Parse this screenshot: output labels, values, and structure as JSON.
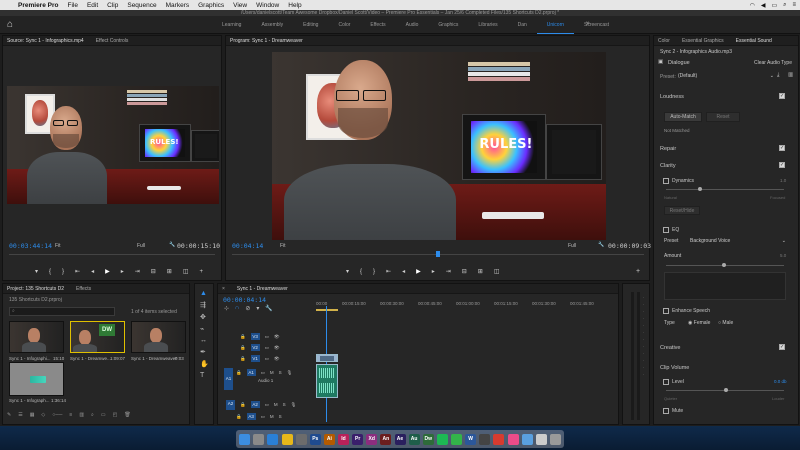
{
  "menubar": {
    "app": "Premiere Pro",
    "items": [
      "File",
      "Edit",
      "Clip",
      "Sequence",
      "Markers",
      "Graphics",
      "View",
      "Window",
      "Help"
    ],
    "status_icons": [
      "wifi-icon",
      "volume-icon",
      "battery-icon",
      "search-icon",
      "menu-icon"
    ]
  },
  "path": "/Users/danielscott/Team Awesome Dropbox/Daniel Scott/Video – Premiere Pro Essentials – Jan 25/6 Completed Files/135 Shortcuts D2.prproj *",
  "workspaces": {
    "tabs": [
      "Learning",
      "Assembly",
      "Editing",
      "Color",
      "Effects",
      "Audio",
      "Graphics",
      "Libraries",
      "Dan",
      "Unicorn",
      "Screencast"
    ],
    "active": "Unicorn",
    "more": "»"
  },
  "source": {
    "tab_label": "Source: Sync 1 - Infographics.mp4",
    "tab2": "Effect Controls",
    "timecode": "00:03:44:14",
    "fit": "Fit",
    "quality": "Full",
    "duration": "00:00:15:10"
  },
  "program": {
    "tab_label": "Program: Sync 1 - Dreamweaver",
    "timecode": "00:04:14",
    "fit": "Fit",
    "quality": "Full",
    "duration": "00:00:09:03",
    "monitor_text": "RULES!"
  },
  "project": {
    "tab_label": "Project: 135 Shortcuts D2",
    "tab2": "Effects",
    "filename": "135 Shortcuts D2.prproj",
    "selection": "1 of 4 items selected",
    "items": [
      {
        "name": "Sync 1 - Infographi...",
        "duration": "15:10"
      },
      {
        "name": "Sync 1 - Dreamwe...",
        "duration": "1:09:07"
      },
      {
        "name": "Sync 1 - Dreamweaver",
        "duration": "9:03"
      },
      {
        "name": "Sync 1 - Infograph...",
        "duration": "1:36:14"
      }
    ]
  },
  "timeline": {
    "tab_label": "Sync 1 - Dreamweaver",
    "timecode": "00:00:04:14",
    "ruler": [
      "00:00",
      "00:00:15:00",
      "00:00:30:00",
      "00:00:45:00",
      "00:01:00:00",
      "00:01:15:00",
      "00:01:30:00",
      "00:01:45:00"
    ],
    "tracks_video": [
      "V3",
      "V2",
      "V1"
    ],
    "tracks_audio": [
      "A1",
      "A2",
      "A3"
    ],
    "audio_label": "Audio 1",
    "audio_master": "A1"
  },
  "essential_sound": {
    "tabs": [
      "Color",
      "Essential Graphics",
      "Essential Sound"
    ],
    "active_tab": "Essential Sound",
    "clip_name": "Sync 2 - Infographics Audio.mp3",
    "type": "Dialogue",
    "clear": "Clear Audio Type",
    "preset_label": "Preset:",
    "preset_value": "(Default)",
    "loudness": "Loudness",
    "auto_match": "Auto-Match",
    "reset": "Reset",
    "not_matched": "Not Matched",
    "repair": "Repair",
    "clarity": "Clarity",
    "dynamics": "Dynamics",
    "dynamics_value": "1.0",
    "dyn_left": "Natural",
    "dyn_right": "Focused",
    "reset2": "Reset/Hide",
    "eq": "EQ",
    "eq_preset_label": "Preset",
    "eq_preset_value": "Background Voice",
    "amount": "Amount",
    "amount_value": "5.0",
    "enhance": "Enhance Speech",
    "type_label": "Type",
    "female": "Female",
    "male": "Male",
    "creative": "Creative",
    "clip_volume": "Clip Volume",
    "level": "Level",
    "level_value": "0.0 db",
    "quieter": "Quieter",
    "louder": "Louder",
    "mute": "Mute"
  },
  "dock": {
    "apps": [
      {
        "name": "finder",
        "color": "#3c8de0",
        "label": ""
      },
      {
        "name": "launchpad",
        "color": "#8a8a8a",
        "label": ""
      },
      {
        "name": "safari",
        "color": "#2a7fd6",
        "label": ""
      },
      {
        "name": "chrome",
        "color": "#e6b71a",
        "label": ""
      },
      {
        "name": "system",
        "color": "#6c6c6c",
        "label": ""
      },
      {
        "name": "ps",
        "color": "#1f4b8f",
        "label": "Ps"
      },
      {
        "name": "ai",
        "color": "#b35a00",
        "label": "Ai"
      },
      {
        "name": "id",
        "color": "#b8215a",
        "label": "Id"
      },
      {
        "name": "pr",
        "color": "#3a1f6b",
        "label": "Pr"
      },
      {
        "name": "xd",
        "color": "#8c2d7f",
        "label": "Xd"
      },
      {
        "name": "an",
        "color": "#6b1e1e",
        "label": "An"
      },
      {
        "name": "ae",
        "color": "#2a1f5e",
        "label": "Ae"
      },
      {
        "name": "au",
        "color": "#1f5e4a",
        "label": "Au"
      },
      {
        "name": "dw",
        "color": "#2e6b3a",
        "label": "Dw"
      },
      {
        "name": "spotify",
        "color": "#1db954",
        "label": ""
      },
      {
        "name": "messages",
        "color": "#33b44a",
        "label": ""
      },
      {
        "name": "word",
        "color": "#2b579a",
        "label": "W"
      },
      {
        "name": "screen",
        "color": "#444444",
        "label": ""
      },
      {
        "name": "record",
        "color": "#d63b2f",
        "label": ""
      },
      {
        "name": "music",
        "color": "#ea4c89",
        "label": ""
      },
      {
        "name": "folder",
        "color": "#5aa0e0",
        "label": ""
      },
      {
        "name": "photos",
        "color": "#cccccc",
        "label": ""
      },
      {
        "name": "trash",
        "color": "#9a9a9a",
        "label": ""
      }
    ]
  }
}
